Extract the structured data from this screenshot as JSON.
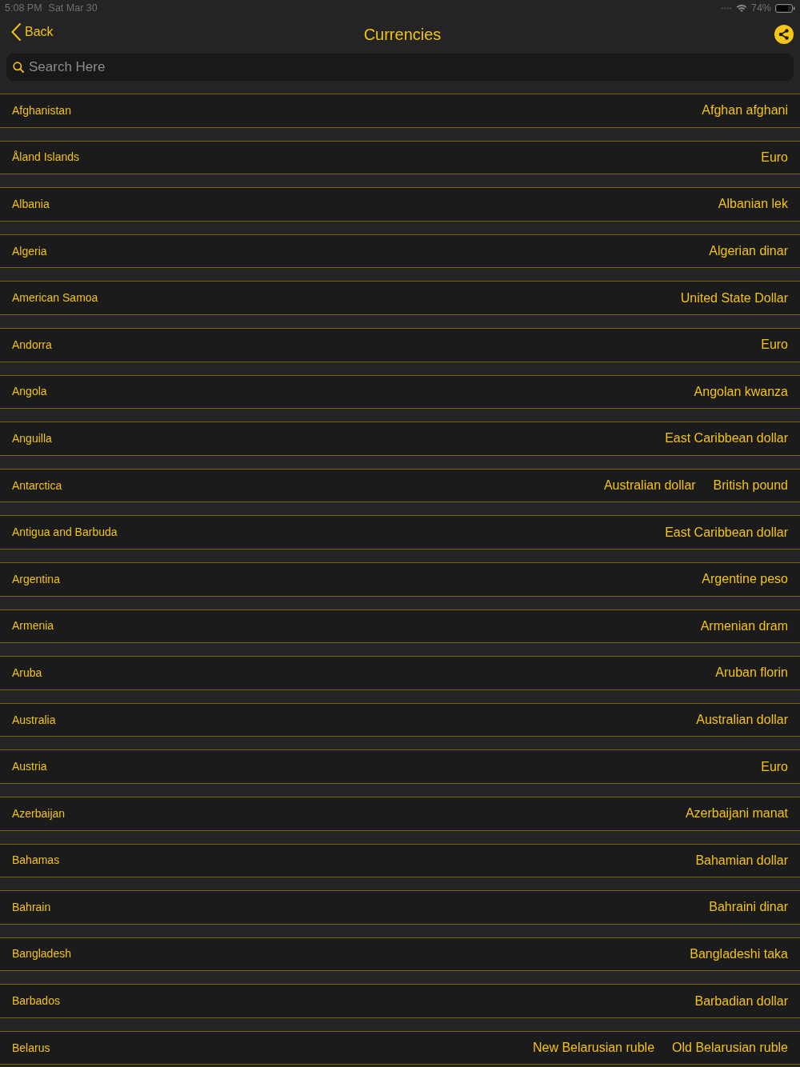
{
  "status_bar": {
    "time": "5:08 PM",
    "date": "Sat Mar 30",
    "battery": "74%"
  },
  "nav": {
    "back": "Back",
    "title": "Currencies"
  },
  "search": {
    "placeholder": "Search Here"
  },
  "rows": [
    {
      "country": "Afghanistan",
      "currencies": [
        "Afghan afghani"
      ]
    },
    {
      "country": "Åland Islands",
      "currencies": [
        "Euro"
      ]
    },
    {
      "country": "Albania",
      "currencies": [
        "Albanian lek"
      ]
    },
    {
      "country": "Algeria",
      "currencies": [
        "Algerian dinar"
      ]
    },
    {
      "country": "American Samoa",
      "currencies": [
        "United State Dollar"
      ]
    },
    {
      "country": "Andorra",
      "currencies": [
        "Euro"
      ]
    },
    {
      "country": "Angola",
      "currencies": [
        "Angolan kwanza"
      ]
    },
    {
      "country": "Anguilla",
      "currencies": [
        "East Caribbean dollar"
      ]
    },
    {
      "country": "Antarctica",
      "currencies": [
        "Australian dollar",
        "British pound"
      ]
    },
    {
      "country": "Antigua and Barbuda",
      "currencies": [
        "East Caribbean dollar"
      ]
    },
    {
      "country": "Argentina",
      "currencies": [
        "Argentine peso"
      ]
    },
    {
      "country": "Armenia",
      "currencies": [
        "Armenian dram"
      ]
    },
    {
      "country": "Aruba",
      "currencies": [
        "Aruban florin"
      ]
    },
    {
      "country": "Australia",
      "currencies": [
        "Australian dollar"
      ]
    },
    {
      "country": "Austria",
      "currencies": [
        "Euro"
      ]
    },
    {
      "country": "Azerbaijan",
      "currencies": [
        "Azerbaijani manat"
      ]
    },
    {
      "country": "Bahamas",
      "currencies": [
        "Bahamian dollar"
      ]
    },
    {
      "country": "Bahrain",
      "currencies": [
        "Bahraini dinar"
      ]
    },
    {
      "country": "Bangladesh",
      "currencies": [
        "Bangladeshi taka"
      ]
    },
    {
      "country": "Barbados",
      "currencies": [
        "Barbadian dollar"
      ]
    },
    {
      "country": "Belarus",
      "currencies": [
        "New Belarusian ruble",
        "Old Belarusian ruble"
      ]
    }
  ]
}
